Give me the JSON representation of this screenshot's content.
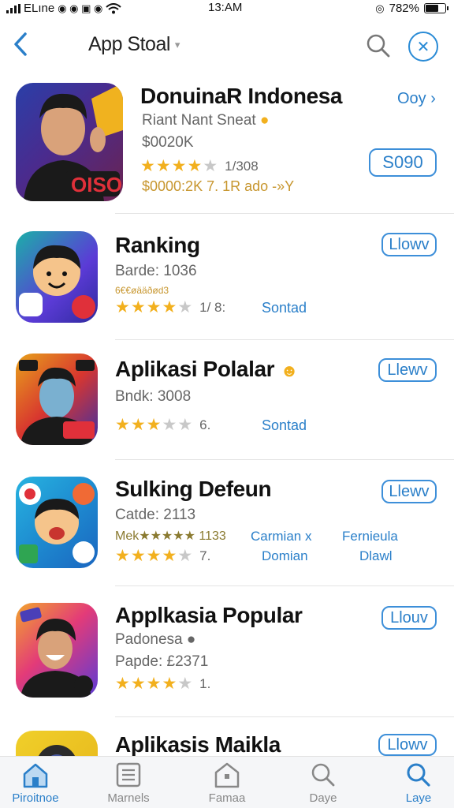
{
  "status_bar": {
    "carrier": "ELıne",
    "time": "13:AM",
    "battery": "782%"
  },
  "nav": {
    "back_icon": "chevron-left-icon",
    "title": "App Stoal",
    "search_icon": "search-icon",
    "compass_icon": "compass-icon"
  },
  "featured": {
    "title": "DonuinaR Indonesa",
    "link": "Ooy",
    "developer": "Riant Nant Sneat",
    "price_text": "$0020K",
    "rating_count": "1/308",
    "promo_line": "$0000:2K 7. 1R ado -»Y",
    "action_label": "S090",
    "badge_text": "OISO",
    "rating": 4
  },
  "apps": [
    {
      "title": "Ranking",
      "subtitle": "Barde: 1036",
      "note": "6€€øääðød3",
      "rating": 4,
      "rating_count": "1/ 8:",
      "link": "Sontad",
      "action_label": "Llowv"
    },
    {
      "title": "Aplikasi Polalar",
      "subtitle": "Bndk: 3008",
      "rating": 3,
      "rating_count": "6.",
      "link": "Sontad",
      "action_label": "Llewv"
    },
    {
      "title": "Sulking Defeun",
      "subtitle": "Catde: 2113",
      "note": "Mek★★★★★ 1133",
      "rating": 4,
      "rating_count": "7.",
      "links": [
        "Carmian х",
        "Domian",
        "Fernieula",
        "Dlawl"
      ],
      "action_label": "Llewv"
    },
    {
      "title": "Applkasia Popular",
      "subtitle": "Padonesa",
      "subtitle2": "Papde: £2371",
      "rating": 4,
      "rating_count": "1.",
      "action_label": "Llouv"
    },
    {
      "title": "Aplikasis Maikla",
      "action_label": "Llowv"
    }
  ],
  "tabbar": {
    "tabs": [
      {
        "label": "Piroitnoe",
        "icon": "home-icon"
      },
      {
        "label": "Marnels",
        "icon": "list-icon"
      },
      {
        "label": "Famaa",
        "icon": "building-icon"
      },
      {
        "label": "Daye",
        "icon": "search-icon"
      },
      {
        "label": "Laye",
        "icon": "search-icon"
      }
    ]
  }
}
